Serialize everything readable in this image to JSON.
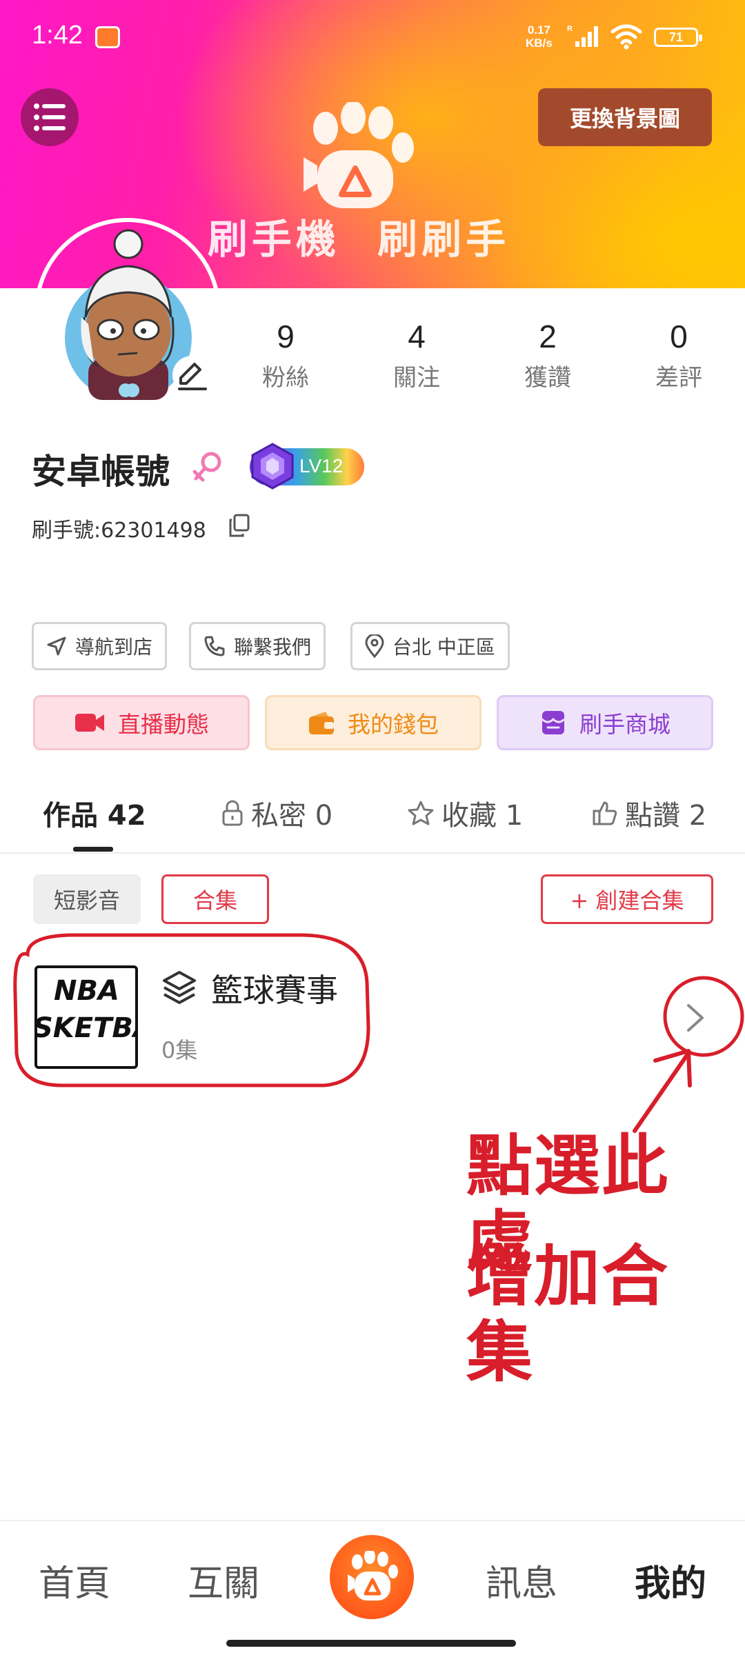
{
  "status_bar": {
    "time": "1:42",
    "network_speed_value": "0.17",
    "network_speed_unit": "KB/s",
    "battery": "71"
  },
  "header": {
    "change_background_label": "更換背景圖",
    "slogan": "刷手機 刷刷手",
    "banner_colors": [
      "#ff17c8",
      "#ff5a6a",
      "#ffc20a"
    ]
  },
  "profile": {
    "stats": [
      {
        "value": "9",
        "label": "粉絲"
      },
      {
        "value": "4",
        "label": "關注"
      },
      {
        "value": "2",
        "label": "獲讚"
      },
      {
        "value": "0",
        "label": "差評"
      }
    ],
    "name": "安卓帳號",
    "gender_icon": "female-icon",
    "level": "LV12",
    "user_id": "刷手號:62301498"
  },
  "chips": [
    {
      "label": "導航到店",
      "icon": "navigation-icon"
    },
    {
      "label": "聯繫我們",
      "icon": "phone-icon"
    },
    {
      "label": "台北 中正區",
      "icon": "location-pin-icon"
    }
  ],
  "actions": [
    {
      "label": "直播動態",
      "icon": "video-camera-icon",
      "color": "#e8304a"
    },
    {
      "label": "我的錢包",
      "icon": "wallet-icon",
      "color": "#f08a17"
    },
    {
      "label": "刷手商城",
      "icon": "store-icon",
      "color": "#8a3ed0"
    }
  ],
  "tabs": [
    {
      "label": "作品 42",
      "active": true
    },
    {
      "label": "私密 0",
      "icon": "lock-icon"
    },
    {
      "label": "收藏 1",
      "icon": "star-icon"
    },
    {
      "label": "點讚 2",
      "icon": "thumbs-up-icon"
    }
  ],
  "filters": {
    "short_video": "短影音",
    "collection": "合集",
    "create_collection": "+ 創建合集"
  },
  "collection_item": {
    "thumb_line1": "NBA",
    "thumb_line2": "SKETBA",
    "title": "籃球賽事",
    "count": "0集"
  },
  "annotation": {
    "line1": "點選此處",
    "line2": "增加合集",
    "color": "#d81e2a"
  },
  "bottom_nav": [
    {
      "label": "首頁"
    },
    {
      "label": "互關"
    },
    {
      "label": "訊息"
    },
    {
      "label": "我的",
      "active": true
    }
  ]
}
